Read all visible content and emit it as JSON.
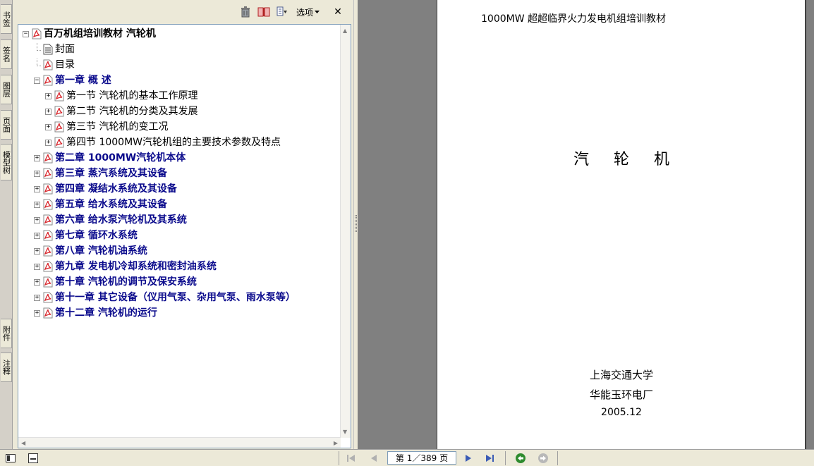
{
  "side_tabs": [
    "书签",
    "签名",
    "图层",
    "页面",
    "模型树",
    "附件",
    "注释"
  ],
  "panel_toolbar": {
    "options_label": "选项",
    "icons": [
      "trash-icon",
      "new-bookmark-icon",
      "expand-bookmark-icon",
      "chevron-down-icon",
      "close-icon"
    ],
    "close_glyph": "✕"
  },
  "bookmarks": {
    "root": "百万机组培训教材 汽轮机",
    "items": [
      {
        "label": "封面",
        "style": "section",
        "level": 1,
        "expander": "none",
        "icon": "page"
      },
      {
        "label": "目录",
        "style": "section",
        "level": 1,
        "expander": "none",
        "icon": "pdf"
      },
      {
        "label": "第一章 概 述",
        "style": "chapter",
        "level": 1,
        "expander": "minus",
        "icon": "pdf"
      },
      {
        "label": "第一节 汽轮机的基本工作原理",
        "style": "section",
        "level": 2,
        "expander": "plus",
        "icon": "pdf"
      },
      {
        "label": "第二节 汽轮机的分类及其发展",
        "style": "section",
        "level": 2,
        "expander": "plus",
        "icon": "pdf"
      },
      {
        "label": "第三节 汽轮机的变工况",
        "style": "section",
        "level": 2,
        "expander": "plus",
        "icon": "pdf"
      },
      {
        "label": "第四节 1000MW汽轮机组的主要技术参数及特点",
        "style": "section",
        "level": 2,
        "expander": "plus",
        "icon": "pdf"
      },
      {
        "label": "第二章 1000MW汽轮机本体",
        "style": "chapter",
        "level": 1,
        "expander": "plus",
        "icon": "pdf"
      },
      {
        "label": "第三章 蒸汽系统及其设备",
        "style": "chapter",
        "level": 1,
        "expander": "plus",
        "icon": "pdf"
      },
      {
        "label": "第四章  凝结水系统及其设备",
        "style": "chapter",
        "level": 1,
        "expander": "plus",
        "icon": "pdf"
      },
      {
        "label": "第五章  给水系统及其设备",
        "style": "chapter",
        "level": 1,
        "expander": "plus",
        "icon": "pdf"
      },
      {
        "label": "第六章  给水泵汽轮机及其系统",
        "style": "chapter",
        "level": 1,
        "expander": "plus",
        "icon": "pdf"
      },
      {
        "label": "第七章  循环水系统",
        "style": "chapter",
        "level": 1,
        "expander": "plus",
        "icon": "pdf"
      },
      {
        "label": "第八章  汽轮机油系统",
        "style": "chapter",
        "level": 1,
        "expander": "plus",
        "icon": "pdf"
      },
      {
        "label": "第九章 发电机冷却系统和密封油系统",
        "style": "chapter",
        "level": 1,
        "expander": "plus",
        "icon": "pdf"
      },
      {
        "label": "第十章 汽轮机的调节及保安系统",
        "style": "chapter",
        "level": 1,
        "expander": "plus",
        "icon": "pdf"
      },
      {
        "label": "第十一章 其它设备（仪用气泵、杂用气泵、雨水泵等）",
        "style": "chapter",
        "level": 1,
        "expander": "plus",
        "icon": "pdf"
      },
      {
        "label": "第十二章 汽轮机的运行",
        "style": "chapter",
        "level": 1,
        "expander": "plus",
        "icon": "pdf"
      }
    ]
  },
  "document": {
    "header": "1000MW 超超临界火力发电机组培训教材",
    "title": "汽 轮 机",
    "org1": "上海交通大学",
    "org2": "华能玉环电厂",
    "date": "2005.12"
  },
  "statusbar": {
    "page_indicator": "第 1／389 页",
    "icons": [
      "show-panel-icon",
      "page-view-icon",
      "first-page-icon",
      "previous-page-icon",
      "next-page-icon",
      "last-page-icon",
      "go-back-icon",
      "go-forward-icon"
    ]
  },
  "colors": {
    "chapter_text": "#0a0a8c",
    "pdf_icon_red": "#d9262c",
    "nav_green": "#2e8b2e"
  }
}
